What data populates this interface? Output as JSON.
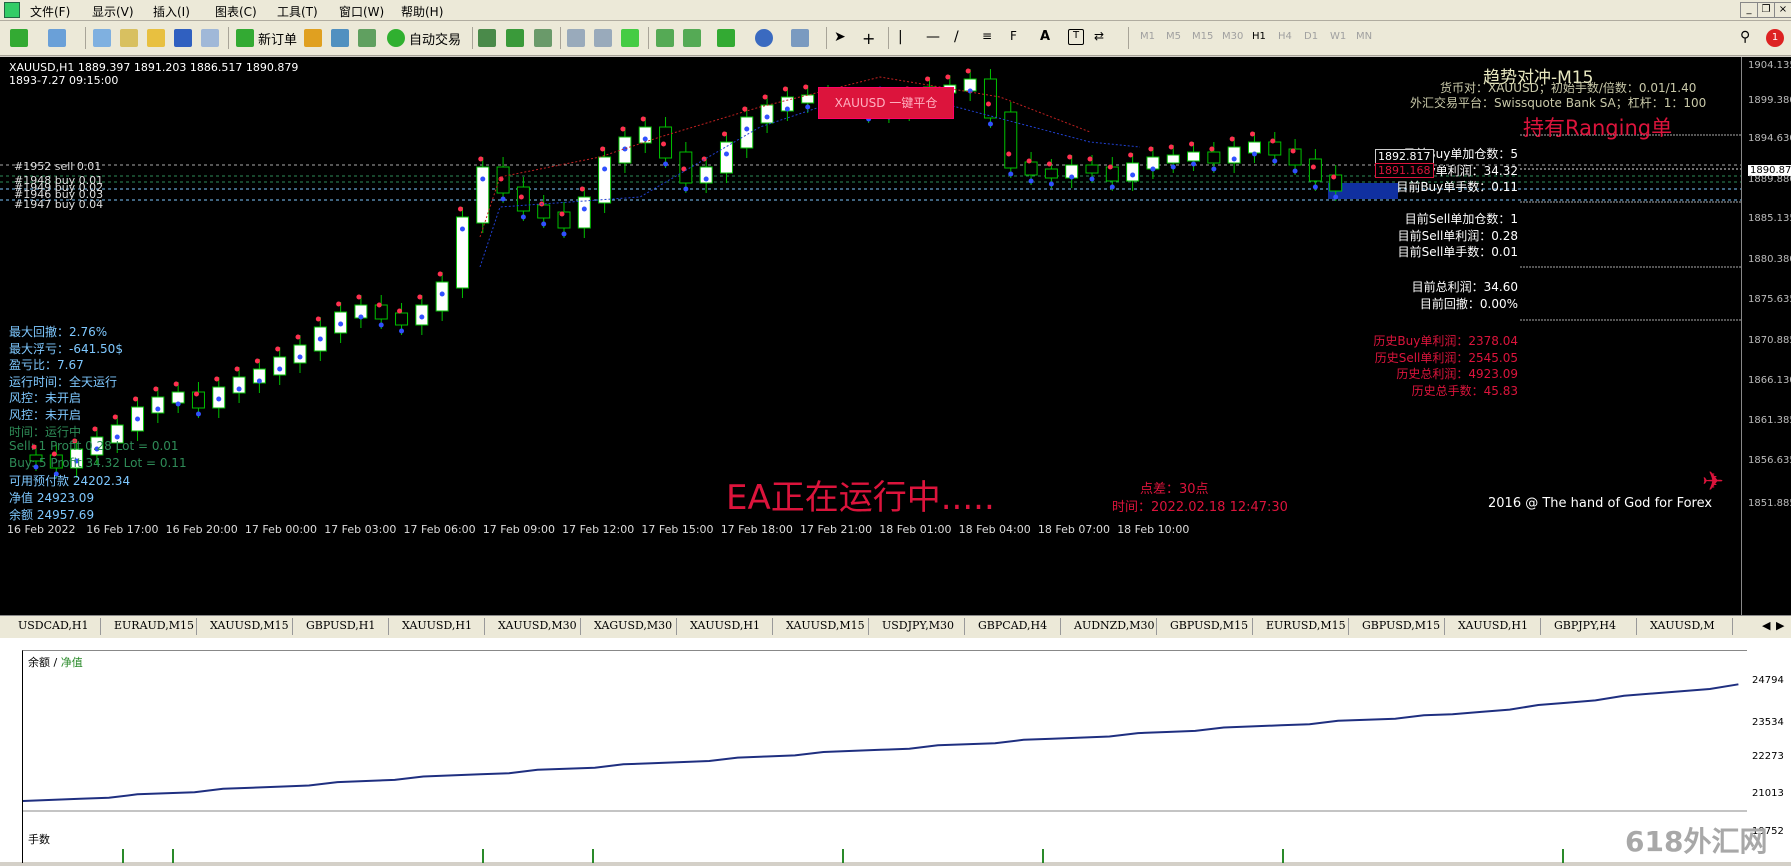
{
  "menu": [
    "文件(F)",
    "显示(V)",
    "插入(I)",
    "图表(C)",
    "工具(T)",
    "窗口(W)",
    "帮助(H)"
  ],
  "toolbar": {
    "new_order": "新订单",
    "auto_trade": "自动交易",
    "timeframes": [
      "M1",
      "M5",
      "M15",
      "M30",
      "H1",
      "H4",
      "D1",
      "W1",
      "MN"
    ]
  },
  "chart": {
    "symbol_line": "XAUUSD,H1  1889.397 1891.203 1886.517 1890.879",
    "sub_line": "1893-7.27    09:15:00",
    "orders": [
      "#1952 sell 0.01",
      "#1948 buy 0.01",
      "#1949 buy 0.02",
      "#1946 buy 0.03",
      "#1947 buy 0.04"
    ],
    "stats_left": [
      {
        "t": "最大回撤：2.76%",
        "c": "#7ec8ff"
      },
      {
        "t": "最大浮亏：-641.50$",
        "c": "#7ec8ff"
      },
      {
        "t": "盈亏比：7.67",
        "c": "#7ec8ff"
      },
      {
        "t": "运行时间：全天运行",
        "c": "#7ec8ff"
      },
      {
        "t": "风控：未开启",
        "c": "#7ec8ff"
      },
      {
        "t": "风控：未开启",
        "c": "#7ec8ff"
      },
      {
        "t": "时间：运行中",
        "c": "#2e8b57"
      },
      {
        "t": "Sell: 1  Profit 0.28  Lot = 0.01",
        "c": "#2e8b57"
      },
      {
        "t": "Buy: 5  Profit 34.32  Lot = 0.11",
        "c": "#2e8b57"
      },
      {
        "t": "可用预付款 24202.34",
        "c": "#7ec8ff"
      },
      {
        "t": "净值 24923.09",
        "c": "#7ec8ff"
      },
      {
        "t": "余额 24957.69",
        "c": "#7ec8ff"
      }
    ],
    "panel_title": "趋势对冲-M15",
    "panel_sub1": "货币对：XAUUSD；初始手数/倍数：0.01/1.40",
    "panel_sub2": "外汇交易平台：Swissquote Bank SA；杠杆：1：100",
    "holding": "持有Ranging单",
    "buy_stats": [
      "目前Buy单加仓数：5",
      "目前Buy单利润：34.32",
      "目前Buy单手数：0.11"
    ],
    "sell_stats": [
      "目前Sell单加仓数：1",
      "目前Sell单利润：0.28",
      "目前Sell单手数：0.01"
    ],
    "total_stats": [
      "目前总利润：34.60",
      "目前回撤：0.00%"
    ],
    "history_stats": [
      "历史Buy单利润：2378.04",
      "历史Sell单利润：2545.05",
      "历史总利润：4923.09",
      "历史总手数：45.83"
    ],
    "close_label": "XAUUSD 一键平仓",
    "price_box1": "1892.817",
    "price_box2": "1891.168",
    "ea_running": "EA正在运行中.....",
    "spread": "点差：30点",
    "time_label": "时间：2022.02.18 12:47:30",
    "copyright": "2016 @ The hand of God for Forex",
    "price_ticks": [
      "1904.135",
      "1899.380",
      "1894.630",
      "1890.879",
      "1889.880",
      "1885.135",
      "1880.380",
      "1875.635",
      "1870.885",
      "1866.130",
      "1861.385",
      "1856.635",
      "1851.885"
    ],
    "time_ticks": [
      "16 Feb 2022",
      "16 Feb 17:00",
      "16 Feb 20:00",
      "17 Feb 00:00",
      "17 Feb 03:00",
      "17 Feb 06:00",
      "17 Feb 09:00",
      "17 Feb 12:00",
      "17 Feb 15:00",
      "17 Feb 18:00",
      "17 Feb 21:00",
      "18 Feb 01:00",
      "18 Feb 04:00",
      "18 Feb 07:00",
      "18 Feb 10:00"
    ]
  },
  "tabs": [
    "USDCAD,H1",
    "EURAUD,M15",
    "XAUUSD,M15",
    "GBPUSD,H1",
    "XAUUSD,H1",
    "XAUUSD,M30",
    "XAGUSD,M30",
    "XAUUSD,H1",
    "XAUUSD,M15",
    "USDJPY,M30",
    "GBPCAD,H4",
    "AUDNZD,M30",
    "GBPUSD,M15",
    "EURUSD,M15",
    "GBPUSD,M15",
    "XAUUSD,H1",
    "GBPJPY,H4",
    "XAUUSD,M"
  ],
  "equity": {
    "legend_balance": "余额",
    "legend_sep": " / ",
    "legend_equity": "净值",
    "lots_label": "手数",
    "y_ticks": [
      "24794",
      "23534",
      "22273",
      "21013",
      "19752"
    ],
    "watermark": "618外汇网"
  },
  "colors": {
    "candle_up": "#00c000",
    "candle_body": "#ffffff",
    "title": "#e8e8c0",
    "holding": "#dc143c",
    "ea": "#dc143c",
    "history": "#dc143c",
    "equity_line": "#1f2f80"
  }
}
